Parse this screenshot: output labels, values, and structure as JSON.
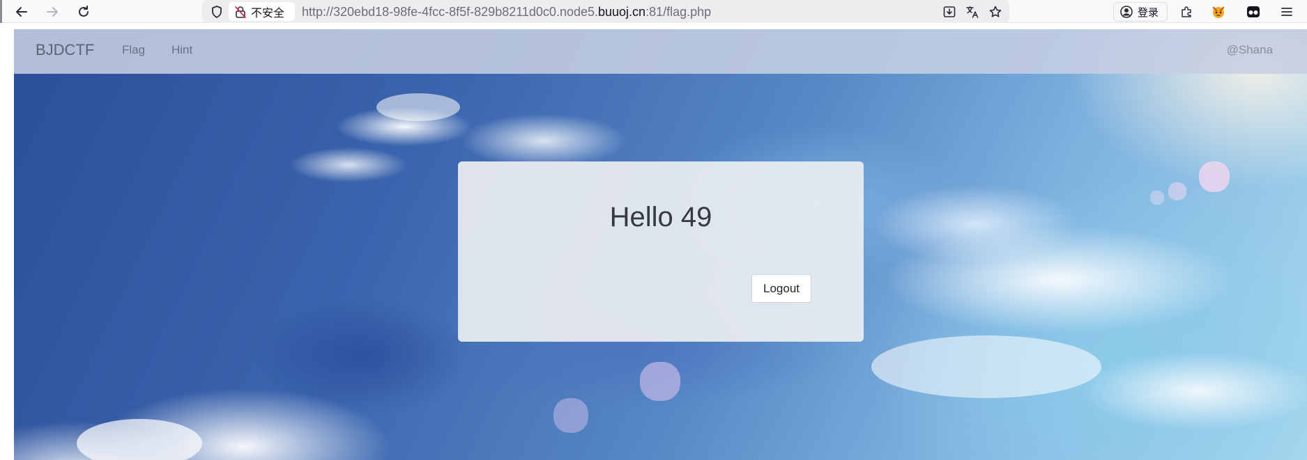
{
  "browser": {
    "security_label": "不安全",
    "url": {
      "prefix": "http://320ebd18-98fe-4fcc-8f5f-829b8211d0c0.node5.",
      "domain": "buuoj.cn",
      "suffix": ":81/flag.php"
    },
    "login_label": "登录",
    "icons": {
      "back": "back-arrow-icon",
      "forward": "forward-arrow-icon",
      "reload": "reload-icon",
      "shield": "shield-icon",
      "insecure": "insecure-lock-icon",
      "save": "save-page-icon",
      "translate": "translate-icon",
      "bookmark": "star-icon",
      "account": "account-icon",
      "extensions": "extensions-icon",
      "fox": "fox-icon",
      "incognito": "private-mask-icon",
      "menu": "hamburger-menu-icon"
    }
  },
  "site": {
    "brand": "BJDCTF",
    "nav": [
      "Flag",
      "Hint"
    ],
    "user": "@Shana"
  },
  "card": {
    "title": "Hello 49",
    "logout_label": "Logout"
  },
  "colors": {
    "navbar": "#c6cee2",
    "card": "#eceef2",
    "sky_dark": "#2b4e98",
    "sky_light": "#a9d9ee"
  }
}
